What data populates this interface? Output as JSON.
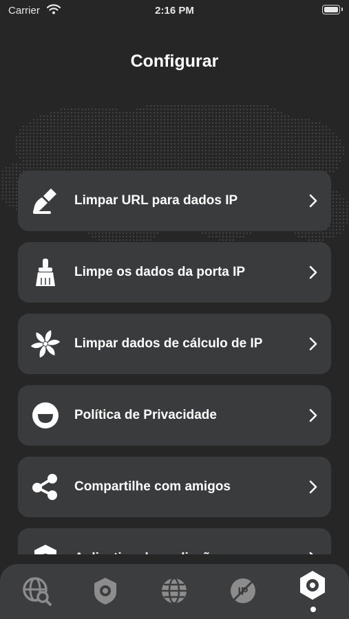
{
  "status": {
    "carrier": "Carrier",
    "time": "2:16 PM"
  },
  "header": {
    "title": "Configurar"
  },
  "menu": [
    {
      "label": "Limpar URL para dados IP",
      "icon": "broom-icon"
    },
    {
      "label": "Limpe os dados da porta IP",
      "icon": "brush-icon"
    },
    {
      "label": "Limpar dados de cálculo de IP",
      "icon": "pinwheel-icon"
    },
    {
      "label": "Política de Privacidade",
      "icon": "smiley-icon"
    },
    {
      "label": "Compartilhe com amigos",
      "icon": "share-icon"
    },
    {
      "label": "Aplicativo de avaliação",
      "icon": "rate-icon"
    }
  ],
  "tabs": [
    {
      "name": "globe-search-icon",
      "active": false
    },
    {
      "name": "shield-icon",
      "active": false
    },
    {
      "name": "globe-icon",
      "active": false
    },
    {
      "name": "ip-crossed-icon",
      "active": false
    },
    {
      "name": "settings-gear-icon",
      "active": true
    }
  ],
  "colors": {
    "background": "#262626",
    "card": "#3a3b3c",
    "tabbar": "#3c3d3e",
    "text": "#ffffff",
    "icon_inactive": "#8c8c8c"
  }
}
